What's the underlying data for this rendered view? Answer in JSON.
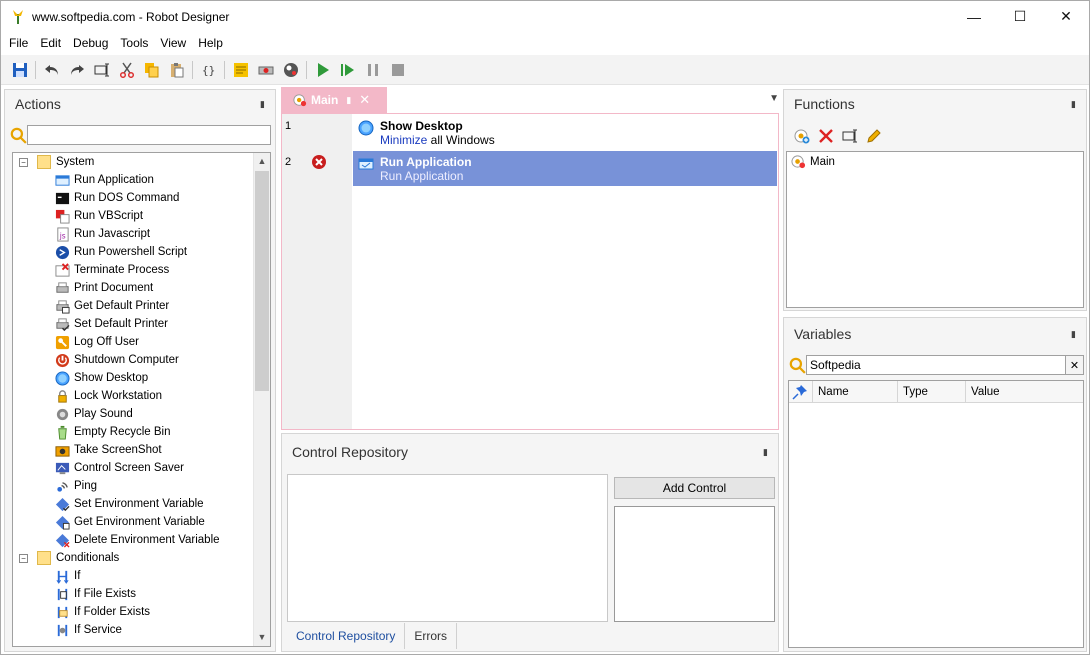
{
  "window": {
    "title": "www.softpedia.com - Robot Designer",
    "minimize": "—",
    "maximize": "☐",
    "close": "✕"
  },
  "menu": [
    "File",
    "Edit",
    "Debug",
    "Tools",
    "View",
    "Help"
  ],
  "toolbar_icons": [
    "save-icon",
    "undo-icon",
    "redo-icon",
    "rename-icon",
    "cut-icon",
    "copy-icon",
    "paste-icon",
    "braces-icon",
    "note-icon",
    "record-icon",
    "web-icon",
    "run-icon",
    "step-run-icon",
    "pause-icon",
    "stop-icon"
  ],
  "actions": {
    "title": "Actions",
    "pin": "▮",
    "search_value": "",
    "groups": [
      {
        "label": "System",
        "expander": "−",
        "items": [
          {
            "label": "Run Application",
            "icon": "app-icon"
          },
          {
            "label": "Run DOS Command",
            "icon": "console-icon"
          },
          {
            "label": "Run VBScript",
            "icon": "vbscript-icon"
          },
          {
            "label": "Run Javascript",
            "icon": "javascript-icon"
          },
          {
            "label": "Run Powershell Script",
            "icon": "powershell-icon"
          },
          {
            "label": "Terminate Process",
            "icon": "terminate-icon"
          },
          {
            "label": "Print Document",
            "icon": "printer-icon"
          },
          {
            "label": "Get Default Printer",
            "icon": "printer-get-icon"
          },
          {
            "label": "Set Default Printer",
            "icon": "printer-set-icon"
          },
          {
            "label": "Log Off User",
            "icon": "key-icon"
          },
          {
            "label": "Shutdown Computer",
            "icon": "power-icon"
          },
          {
            "label": "Show Desktop",
            "icon": "desktop-icon"
          },
          {
            "label": "Lock Workstation",
            "icon": "lock-icon"
          },
          {
            "label": "Play Sound",
            "icon": "sound-icon"
          },
          {
            "label": "Empty Recycle Bin",
            "icon": "recycle-icon"
          },
          {
            "label": "Take ScreenShot",
            "icon": "camera-icon"
          },
          {
            "label": "Control Screen Saver",
            "icon": "screensaver-icon"
          },
          {
            "label": "Ping",
            "icon": "ping-icon"
          },
          {
            "label": "Set Environment Variable",
            "icon": "env-set-icon"
          },
          {
            "label": "Get Environment Variable",
            "icon": "env-get-icon"
          },
          {
            "label": "Delete Environment Variable",
            "icon": "env-delete-icon"
          }
        ]
      },
      {
        "label": "Conditionals",
        "expander": "−",
        "items": [
          {
            "label": "If",
            "icon": "if-icon"
          },
          {
            "label": "If File Exists",
            "icon": "if-file-icon"
          },
          {
            "label": "If Folder Exists",
            "icon": "if-folder-icon"
          },
          {
            "label": "If Service",
            "icon": "if-service-icon"
          }
        ]
      }
    ],
    "scroll_up": "▲",
    "scroll_down": "▼"
  },
  "document": {
    "tab_label": "Main",
    "tab_pin": "▮",
    "tab_close": "✕",
    "menu_arrow": "▼",
    "steps": [
      {
        "number": "1",
        "title": "Show Desktop",
        "desc_keyword": "Minimize",
        "desc_rest": " all Windows",
        "icon": "desktop-icon",
        "error": false,
        "selected": false
      },
      {
        "number": "2",
        "title": "Run Application",
        "desc_keyword": "",
        "desc_rest": "Run Application",
        "icon": "app-icon",
        "error": true,
        "selected": true
      }
    ]
  },
  "repository": {
    "title": "Control Repository",
    "add_button": "Add Control",
    "tabs": [
      "Control Repository",
      "Errors"
    ],
    "active_tab": 0
  },
  "functions": {
    "title": "Functions",
    "tools": [
      "add-function-icon",
      "delete-icon",
      "rename-icon",
      "edit-icon"
    ],
    "items": [
      {
        "label": "Main",
        "icon": "function-icon"
      }
    ]
  },
  "variables": {
    "title": "Variables",
    "search_value": "Softpedia",
    "clear": "✕",
    "columns": [
      "Name",
      "Type",
      "Value"
    ]
  },
  "colors": {
    "tab_pink": "#f3b8c8",
    "selection_blue": "#7892d8",
    "keyword_blue": "#1a3bbf"
  }
}
